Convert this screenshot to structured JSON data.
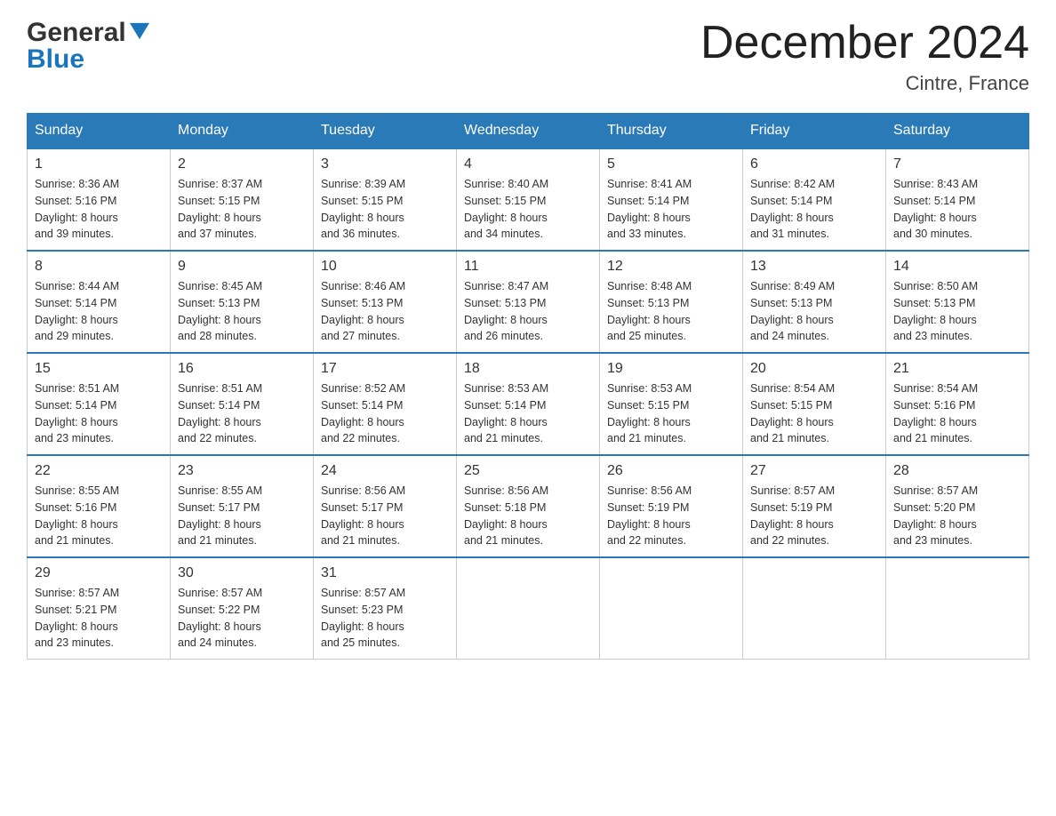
{
  "header": {
    "logo_general": "General",
    "logo_blue": "Blue",
    "month_title": "December 2024",
    "location": "Cintre, France"
  },
  "days_of_week": [
    "Sunday",
    "Monday",
    "Tuesday",
    "Wednesday",
    "Thursday",
    "Friday",
    "Saturday"
  ],
  "weeks": [
    [
      {
        "day": "1",
        "sunrise": "8:36 AM",
        "sunset": "5:16 PM",
        "daylight": "8 hours and 39 minutes."
      },
      {
        "day": "2",
        "sunrise": "8:37 AM",
        "sunset": "5:15 PM",
        "daylight": "8 hours and 37 minutes."
      },
      {
        "day": "3",
        "sunrise": "8:39 AM",
        "sunset": "5:15 PM",
        "daylight": "8 hours and 36 minutes."
      },
      {
        "day": "4",
        "sunrise": "8:40 AM",
        "sunset": "5:15 PM",
        "daylight": "8 hours and 34 minutes."
      },
      {
        "day": "5",
        "sunrise": "8:41 AM",
        "sunset": "5:14 PM",
        "daylight": "8 hours and 33 minutes."
      },
      {
        "day": "6",
        "sunrise": "8:42 AM",
        "sunset": "5:14 PM",
        "daylight": "8 hours and 31 minutes."
      },
      {
        "day": "7",
        "sunrise": "8:43 AM",
        "sunset": "5:14 PM",
        "daylight": "8 hours and 30 minutes."
      }
    ],
    [
      {
        "day": "8",
        "sunrise": "8:44 AM",
        "sunset": "5:14 PM",
        "daylight": "8 hours and 29 minutes."
      },
      {
        "day": "9",
        "sunrise": "8:45 AM",
        "sunset": "5:13 PM",
        "daylight": "8 hours and 28 minutes."
      },
      {
        "day": "10",
        "sunrise": "8:46 AM",
        "sunset": "5:13 PM",
        "daylight": "8 hours and 27 minutes."
      },
      {
        "day": "11",
        "sunrise": "8:47 AM",
        "sunset": "5:13 PM",
        "daylight": "8 hours and 26 minutes."
      },
      {
        "day": "12",
        "sunrise": "8:48 AM",
        "sunset": "5:13 PM",
        "daylight": "8 hours and 25 minutes."
      },
      {
        "day": "13",
        "sunrise": "8:49 AM",
        "sunset": "5:13 PM",
        "daylight": "8 hours and 24 minutes."
      },
      {
        "day": "14",
        "sunrise": "8:50 AM",
        "sunset": "5:13 PM",
        "daylight": "8 hours and 23 minutes."
      }
    ],
    [
      {
        "day": "15",
        "sunrise": "8:51 AM",
        "sunset": "5:14 PM",
        "daylight": "8 hours and 23 minutes."
      },
      {
        "day": "16",
        "sunrise": "8:51 AM",
        "sunset": "5:14 PM",
        "daylight": "8 hours and 22 minutes."
      },
      {
        "day": "17",
        "sunrise": "8:52 AM",
        "sunset": "5:14 PM",
        "daylight": "8 hours and 22 minutes."
      },
      {
        "day": "18",
        "sunrise": "8:53 AM",
        "sunset": "5:14 PM",
        "daylight": "8 hours and 21 minutes."
      },
      {
        "day": "19",
        "sunrise": "8:53 AM",
        "sunset": "5:15 PM",
        "daylight": "8 hours and 21 minutes."
      },
      {
        "day": "20",
        "sunrise": "8:54 AM",
        "sunset": "5:15 PM",
        "daylight": "8 hours and 21 minutes."
      },
      {
        "day": "21",
        "sunrise": "8:54 AM",
        "sunset": "5:16 PM",
        "daylight": "8 hours and 21 minutes."
      }
    ],
    [
      {
        "day": "22",
        "sunrise": "8:55 AM",
        "sunset": "5:16 PM",
        "daylight": "8 hours and 21 minutes."
      },
      {
        "day": "23",
        "sunrise": "8:55 AM",
        "sunset": "5:17 PM",
        "daylight": "8 hours and 21 minutes."
      },
      {
        "day": "24",
        "sunrise": "8:56 AM",
        "sunset": "5:17 PM",
        "daylight": "8 hours and 21 minutes."
      },
      {
        "day": "25",
        "sunrise": "8:56 AM",
        "sunset": "5:18 PM",
        "daylight": "8 hours and 21 minutes."
      },
      {
        "day": "26",
        "sunrise": "8:56 AM",
        "sunset": "5:19 PM",
        "daylight": "8 hours and 22 minutes."
      },
      {
        "day": "27",
        "sunrise": "8:57 AM",
        "sunset": "5:19 PM",
        "daylight": "8 hours and 22 minutes."
      },
      {
        "day": "28",
        "sunrise": "8:57 AM",
        "sunset": "5:20 PM",
        "daylight": "8 hours and 23 minutes."
      }
    ],
    [
      {
        "day": "29",
        "sunrise": "8:57 AM",
        "sunset": "5:21 PM",
        "daylight": "8 hours and 23 minutes."
      },
      {
        "day": "30",
        "sunrise": "8:57 AM",
        "sunset": "5:22 PM",
        "daylight": "8 hours and 24 minutes."
      },
      {
        "day": "31",
        "sunrise": "8:57 AM",
        "sunset": "5:23 PM",
        "daylight": "8 hours and 25 minutes."
      },
      null,
      null,
      null,
      null
    ]
  ],
  "labels": {
    "sunrise": "Sunrise:",
    "sunset": "Sunset:",
    "daylight": "Daylight:"
  },
  "colors": {
    "header_bg": "#2a7ab8",
    "header_text": "#ffffff",
    "border": "#2a7ab8",
    "text": "#333333"
  }
}
